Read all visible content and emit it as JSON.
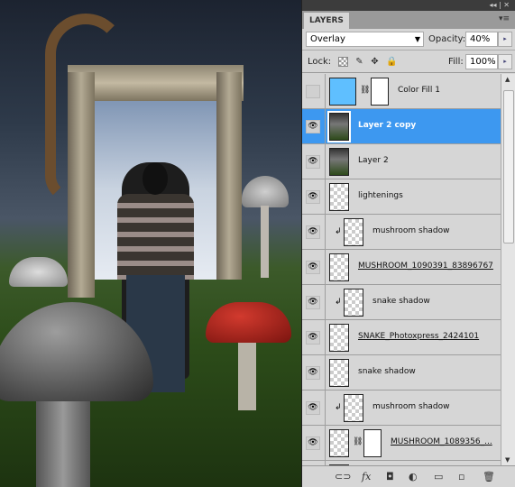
{
  "panel": {
    "title": "LAYERS",
    "blend_mode": "Overlay",
    "opacity_label": "Opacity:",
    "opacity": "40%",
    "lock_label": "Lock:",
    "fill_label": "Fill:",
    "fill": "100%"
  },
  "layers": [
    {
      "name": "Color Fill 1",
      "visible": false,
      "thumb": "fill",
      "mask": true,
      "clipped": false,
      "underline": false,
      "selected": false
    },
    {
      "name": "Layer 2 copy",
      "visible": true,
      "thumb": "photo",
      "mask": false,
      "clipped": false,
      "underline": false,
      "selected": true
    },
    {
      "name": "Layer 2",
      "visible": true,
      "thumb": "photo",
      "mask": false,
      "clipped": false,
      "underline": false,
      "selected": false
    },
    {
      "name": "lightenings",
      "visible": true,
      "thumb": "transparent",
      "mask": false,
      "clipped": false,
      "underline": false,
      "selected": false
    },
    {
      "name": "mushroom shadow",
      "visible": true,
      "thumb": "transparent",
      "mask": false,
      "clipped": true,
      "underline": false,
      "selected": false
    },
    {
      "name": "MUSHROOM_1090391_83896767",
      "visible": true,
      "thumb": "transparent",
      "mask": false,
      "clipped": false,
      "underline": true,
      "selected": false
    },
    {
      "name": "snake shadow",
      "visible": true,
      "thumb": "transparent",
      "mask": false,
      "clipped": true,
      "underline": false,
      "selected": false
    },
    {
      "name": "SNAKE_Photoxpress_2424101",
      "visible": true,
      "thumb": "transparent",
      "mask": false,
      "clipped": false,
      "underline": true,
      "selected": false
    },
    {
      "name": "snake shadow",
      "visible": true,
      "thumb": "transparent",
      "mask": false,
      "clipped": false,
      "underline": false,
      "selected": false
    },
    {
      "name": "mushroom shadow",
      "visible": true,
      "thumb": "transparent",
      "mask": false,
      "clipped": true,
      "underline": false,
      "selected": false
    },
    {
      "name": "MUSHROOM_1089356_...",
      "visible": true,
      "thumb": "transparent",
      "mask": true,
      "clipped": false,
      "underline": true,
      "selected": false
    },
    {
      "name": "",
      "visible": true,
      "thumb": "transparent",
      "mask": false,
      "clipped": false,
      "underline": false,
      "selected": false
    }
  ],
  "colors": {
    "selection": "#3d98f0",
    "panel_bg": "#d6d6d6",
    "fill_color": "#5fbfff"
  }
}
